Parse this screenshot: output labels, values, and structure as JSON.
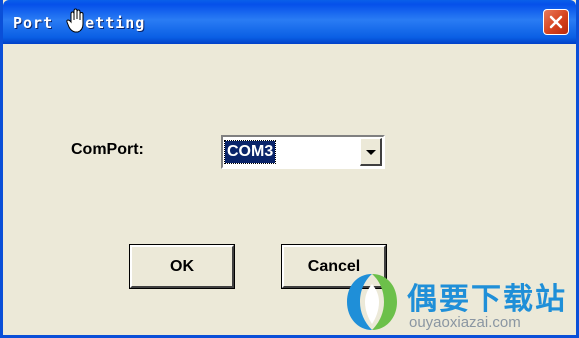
{
  "window": {
    "title": "Port Setting",
    "title_text_before_icon": "Port ",
    "title_text_after_icon": "etting",
    "close_icon": "close-icon"
  },
  "form": {
    "comport_label": "ComPort:",
    "comport_value": "COM3"
  },
  "buttons": {
    "ok_label": "OK",
    "cancel_label": "Cancel"
  },
  "watermark": {
    "brand_text": "偶要下载站",
    "url_text": "ouyaoxiazai.com"
  },
  "colors": {
    "titlebar_blue": "#0a5fe9",
    "dialog_bg": "#ece9d8",
    "selection_bg": "#0a246a",
    "close_red": "#d6421e",
    "watermark_blue": "#1f8fd8"
  }
}
